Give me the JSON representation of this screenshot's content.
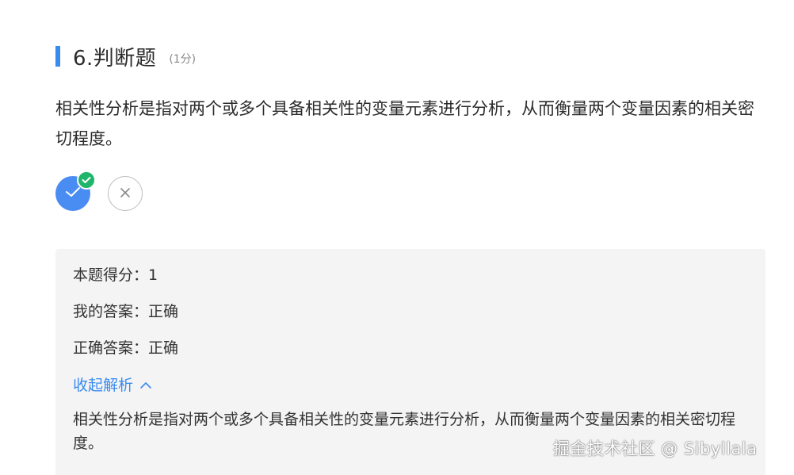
{
  "question": {
    "title": "6.判断题",
    "score": "(1分)",
    "stem": "相关性分析是指对两个或多个具备相关性的变量元素进行分析，从而衡量两个变量因素的相关密切程度。"
  },
  "options": {
    "true_icon": "check-icon",
    "false_icon": "close-icon",
    "selected": "true",
    "badge_icon": "check-badge-icon"
  },
  "result": {
    "score_line": "本题得分：1",
    "my_answer_line": "我的答案：正确",
    "correct_answer_line": "正确答案：正确",
    "toggle_label": "收起解析",
    "analysis": "相关性分析是指对两个或多个具备相关性的变量元素进行分析，从而衡量两个变量因素的相关密切程度。"
  },
  "watermark": "掘金技术社区 @ Sibyllala",
  "colors": {
    "accent": "#3a8bf0",
    "selected_option": "#4a8df2",
    "correct_badge": "#1fb56a",
    "panel_bg": "#f4f4f4"
  }
}
